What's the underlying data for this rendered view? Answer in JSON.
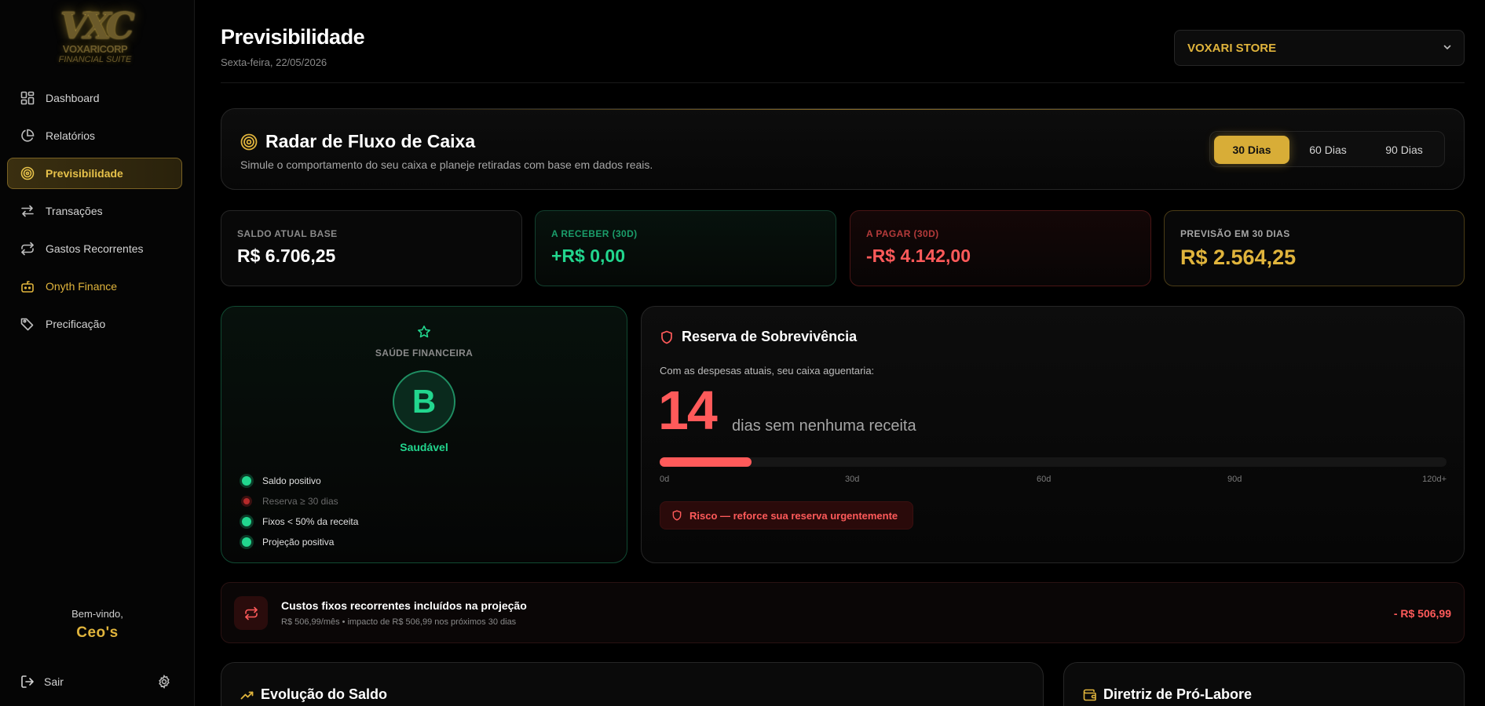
{
  "brand": {
    "mark": "VXC",
    "name": "VOXARICORP",
    "tagline": "FINANCIAL SUITE"
  },
  "sidebar": {
    "items": [
      {
        "label": "Dashboard",
        "icon": "grid-icon"
      },
      {
        "label": "Relatórios",
        "icon": "pie-chart-icon"
      },
      {
        "label": "Previsibilidade",
        "icon": "target-icon",
        "active": true
      },
      {
        "label": "Transações",
        "icon": "arrows-swap-icon"
      },
      {
        "label": "Gastos Recorrentes",
        "icon": "repeat-icon"
      },
      {
        "label": "Onyth Finance",
        "icon": "robot-icon"
      },
      {
        "label": "Precificação",
        "icon": "tag-icon"
      }
    ],
    "welcome": "Bem-vindo,",
    "user": "Ceo's",
    "logout": "Sair"
  },
  "header": {
    "title": "Previsibilidade",
    "date": "Sexta-feira, 22/05/2026",
    "store": "VOXARI STORE"
  },
  "radar": {
    "title": "Radar de Fluxo de Caixa",
    "subtitle": "Simule o comportamento do seu caixa e planeje retiradas com base em dados reais.",
    "periods": [
      "30 Dias",
      "60 Dias",
      "90 Dias"
    ],
    "selected_period": "30 Dias"
  },
  "stats": [
    {
      "label": "SALDO ATUAL BASE",
      "value": "R$ 6.706,25"
    },
    {
      "label": "A RECEBER (30D)",
      "value": "+R$ 0,00"
    },
    {
      "label": "A PAGAR (30D)",
      "value": "-R$ 4.142,00"
    },
    {
      "label": "PREVISÃO EM 30 DIAS",
      "value": "R$ 2.564,25"
    }
  ],
  "health": {
    "label": "SAÚDE FINANCEIRA",
    "grade": "B",
    "status": "Saudável",
    "checks": [
      {
        "label": "Saldo positivo",
        "ok": true
      },
      {
        "label": "Reserva ≥ 30 dias",
        "ok": false
      },
      {
        "label": "Fixos < 50% da receita",
        "ok": true
      },
      {
        "label": "Projeção positiva",
        "ok": true
      }
    ]
  },
  "reserve": {
    "title": "Reserva de Sobrevivência",
    "subtitle": "Com as despesas atuais, seu caixa aguentaria:",
    "days": "14",
    "days_text": "dias sem nenhuma receita",
    "progress_days": 14,
    "max_days": 120,
    "ticks": [
      "0d",
      "30d",
      "60d",
      "90d",
      "120d+"
    ],
    "alert": "Risco — reforce sua reserva urgentemente"
  },
  "fixed_costs": {
    "title": "Custos fixos recorrentes incluídos na projeção",
    "subtitle": "R$ 506,99/mês • impacto de R$ 506,99 nos próximos 30 dias",
    "value": "- R$ 506,99"
  },
  "bottom": {
    "evolution_title": "Evolução do Saldo",
    "prolabore_title": "Diretriz de Pró-Labore"
  },
  "colors": {
    "gold": "#e0b43c",
    "green": "#22d68e",
    "red": "#ff5a5a"
  }
}
